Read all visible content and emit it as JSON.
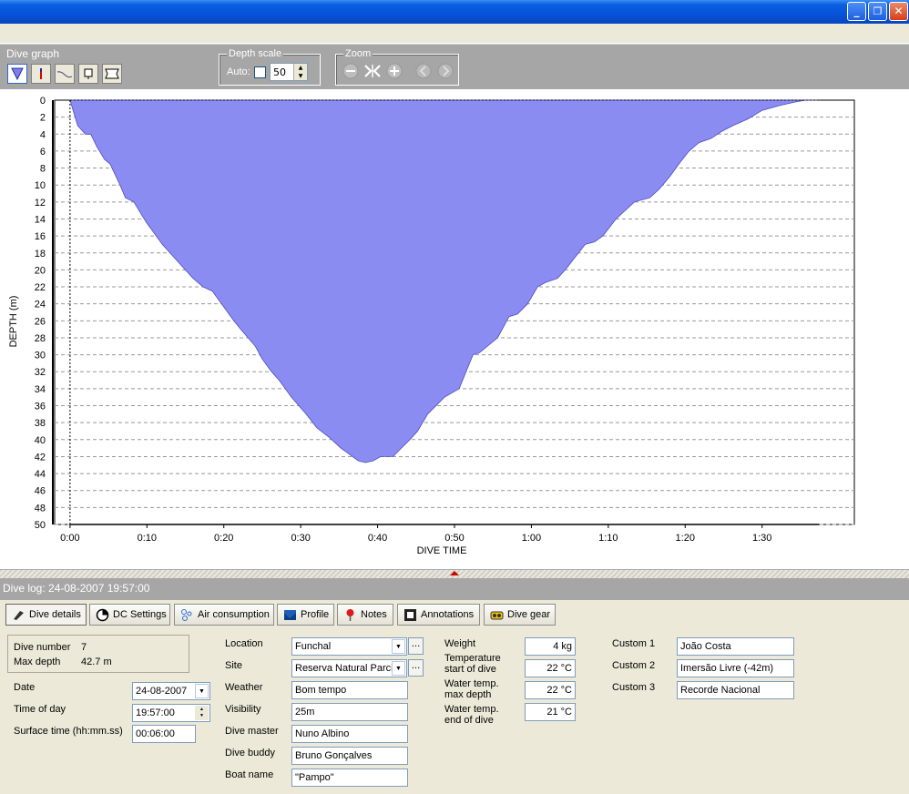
{
  "window": {
    "title": "",
    "controls": {
      "minimize": "_",
      "maximize": "❐",
      "close": "✕"
    }
  },
  "graph_panel": {
    "title": "Dive graph",
    "tools": [
      "profile-tool-icon",
      "marker-tool-icon",
      "line-tool-icon",
      "note-tool-icon",
      "frame-tool-icon"
    ],
    "depth_scale": {
      "legend": "Depth scale",
      "auto_label": "Auto:",
      "auto_checked": false,
      "value": "50"
    },
    "zoom": {
      "legend": "Zoom",
      "buttons": [
        "zoom-out-icon",
        "zoom-fit-icon",
        "zoom-in-icon",
        "previous-icon",
        "next-icon"
      ]
    }
  },
  "chart_data": {
    "type": "area",
    "xlabel": "DIVE TIME",
    "ylabel": "DEPTH (m)",
    "x_ticks": [
      "0:00",
      "0:10",
      "0:20",
      "0:30",
      "0:40",
      "0:50",
      "1:00",
      "1:10",
      "1:20",
      "1:30"
    ],
    "y_ticks": [
      "0",
      "2",
      "4",
      "6",
      "8",
      "10",
      "12",
      "14",
      "16",
      "18",
      "20",
      "22",
      "24",
      "26",
      "28",
      "30",
      "32",
      "34",
      "36",
      "38",
      "40",
      "42",
      "44",
      "46",
      "48",
      "50"
    ],
    "xlim_minutes": [
      -2,
      102
    ],
    "ylim": [
      0,
      50
    ],
    "y_inverted": true,
    "grid": "horizontal-dashed",
    "fill_color": "#8a8cf2",
    "x_minutes": [
      0,
      1,
      2,
      2.7,
      3.5,
      4.5,
      5.2,
      6.5,
      7.2,
      8.3,
      9.3,
      10,
      12,
      14,
      16,
      17.3,
      18.5,
      20.5,
      21.3,
      22.2,
      24.1,
      25,
      26.2,
      27.2,
      28.8,
      30.7,
      32.1,
      33.8,
      35.2,
      36,
      37.5,
      38.4,
      39.4,
      40.4,
      41.4,
      42,
      43.1,
      44.2,
      45.2,
      46.5,
      48.7,
      50.6,
      51.5,
      52.4,
      53.2,
      55.6,
      57.1,
      58.2,
      59.5,
      60.8,
      61.8,
      63.4,
      64.4,
      65.7,
      67,
      68.2,
      69.3,
      71,
      73.4,
      75.4,
      76.6,
      78,
      79.2,
      80.5,
      81.8,
      83.4,
      84.7,
      86.2,
      88.2,
      90,
      92.4,
      94.4,
      95.7,
      96.8,
      97.3,
      97.4
    ],
    "depth_m": [
      0,
      3,
      4,
      4,
      5.5,
      7,
      7.5,
      10,
      11.5,
      12,
      13.5,
      14.5,
      17,
      19,
      21,
      22,
      22.5,
      25,
      26,
      27,
      29,
      30.5,
      32,
      33,
      35,
      37,
      38.6,
      39.8,
      41,
      41.5,
      42.5,
      42.7,
      42.5,
      42,
      42,
      42,
      41,
      40,
      39,
      37,
      35,
      34,
      32,
      30,
      29.8,
      28,
      25.5,
      25.2,
      24,
      22,
      21.5,
      21,
      20,
      18.5,
      17,
      16.7,
      16,
      14,
      12,
      11.5,
      10.5,
      9,
      7.5,
      6,
      5,
      4.5,
      3.7,
      3,
      2.2,
      1.2,
      0.6,
      0.2,
      0,
      0,
      0,
      0
    ]
  },
  "log": {
    "title": "Dive log: 24-08-2007 19:57:00",
    "tabs": [
      {
        "label": "Dive details",
        "icon": "flipper-icon"
      },
      {
        "label": "DC Settings",
        "icon": "gauge-icon"
      },
      {
        "label": "Air consumption",
        "icon": "bubbles-icon"
      },
      {
        "label": "Profile",
        "icon": "profile-icon"
      },
      {
        "label": "Notes",
        "icon": "pin-icon"
      },
      {
        "label": "Annotations",
        "icon": "film-icon"
      },
      {
        "label": "Dive gear",
        "icon": "mask-icon"
      }
    ],
    "details": {
      "dive_number_label": "Dive number",
      "dive_number": "7",
      "max_depth_label": "Max depth",
      "max_depth": "42.7 m",
      "date_label": "Date",
      "date": "24-08-2007",
      "time_label": "Time of day",
      "time": "19:57:00",
      "surface_label": "Surface time (hh:mm.ss)",
      "surface": "00:06:00",
      "location_label": "Location",
      "location": "Funchal",
      "site_label": "Site",
      "site": "Reserva Natural Parcial",
      "weather_label": "Weather",
      "weather": "Bom tempo",
      "visibility_label": "Visibility",
      "visibility": "25m",
      "divemaster_label": "Dive master",
      "divemaster": "Nuno Albino",
      "buddy_label": "Dive buddy",
      "buddy": "Bruno Gonçalves",
      "boat_label": "Boat name",
      "boat": "\"Pampo\"",
      "weight_label": "Weight",
      "weight": "4 kg",
      "temp_start_label_1": "Temperature",
      "temp_start_label_2": "start of dive",
      "temp_start": "22 °C",
      "temp_max_label_1": "Water temp.",
      "temp_max_label_2": "max depth",
      "temp_max": "22 °C",
      "temp_end_label_1": "Water temp.",
      "temp_end_label_2": "end of dive",
      "temp_end": "21 °C",
      "custom1_label": "Custom 1",
      "custom1": "João Costa",
      "custom2_label": "Custom 2",
      "custom2": "Imersão Livre (-42m)",
      "custom3_label": "Custom 3",
      "custom3": "Recorde Nacional",
      "ellipsis": "..."
    }
  }
}
